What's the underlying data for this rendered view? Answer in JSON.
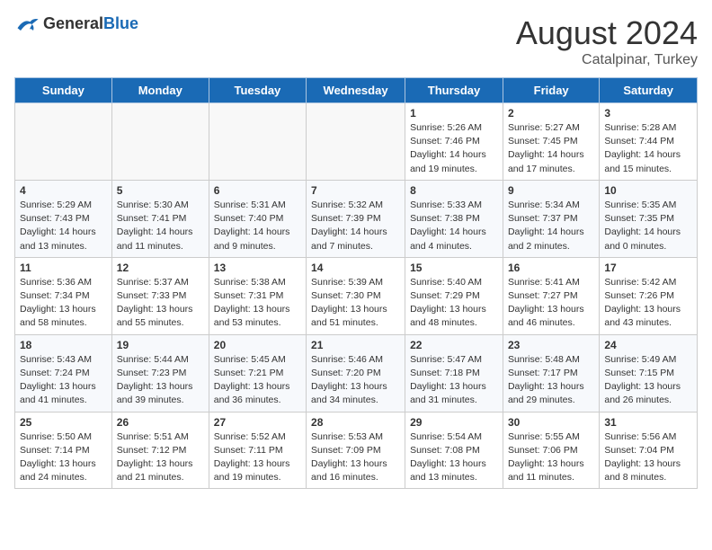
{
  "header": {
    "logo_general": "General",
    "logo_blue": "Blue",
    "month_year": "August 2024",
    "location": "Catalpinar, Turkey"
  },
  "days_of_week": [
    "Sunday",
    "Monday",
    "Tuesday",
    "Wednesday",
    "Thursday",
    "Friday",
    "Saturday"
  ],
  "weeks": [
    [
      {
        "day": "",
        "info": ""
      },
      {
        "day": "",
        "info": ""
      },
      {
        "day": "",
        "info": ""
      },
      {
        "day": "",
        "info": ""
      },
      {
        "day": "1",
        "info": "Sunrise: 5:26 AM\nSunset: 7:46 PM\nDaylight: 14 hours\nand 19 minutes."
      },
      {
        "day": "2",
        "info": "Sunrise: 5:27 AM\nSunset: 7:45 PM\nDaylight: 14 hours\nand 17 minutes."
      },
      {
        "day": "3",
        "info": "Sunrise: 5:28 AM\nSunset: 7:44 PM\nDaylight: 14 hours\nand 15 minutes."
      }
    ],
    [
      {
        "day": "4",
        "info": "Sunrise: 5:29 AM\nSunset: 7:43 PM\nDaylight: 14 hours\nand 13 minutes."
      },
      {
        "day": "5",
        "info": "Sunrise: 5:30 AM\nSunset: 7:41 PM\nDaylight: 14 hours\nand 11 minutes."
      },
      {
        "day": "6",
        "info": "Sunrise: 5:31 AM\nSunset: 7:40 PM\nDaylight: 14 hours\nand 9 minutes."
      },
      {
        "day": "7",
        "info": "Sunrise: 5:32 AM\nSunset: 7:39 PM\nDaylight: 14 hours\nand 7 minutes."
      },
      {
        "day": "8",
        "info": "Sunrise: 5:33 AM\nSunset: 7:38 PM\nDaylight: 14 hours\nand 4 minutes."
      },
      {
        "day": "9",
        "info": "Sunrise: 5:34 AM\nSunset: 7:37 PM\nDaylight: 14 hours\nand 2 minutes."
      },
      {
        "day": "10",
        "info": "Sunrise: 5:35 AM\nSunset: 7:35 PM\nDaylight: 14 hours\nand 0 minutes."
      }
    ],
    [
      {
        "day": "11",
        "info": "Sunrise: 5:36 AM\nSunset: 7:34 PM\nDaylight: 13 hours\nand 58 minutes."
      },
      {
        "day": "12",
        "info": "Sunrise: 5:37 AM\nSunset: 7:33 PM\nDaylight: 13 hours\nand 55 minutes."
      },
      {
        "day": "13",
        "info": "Sunrise: 5:38 AM\nSunset: 7:31 PM\nDaylight: 13 hours\nand 53 minutes."
      },
      {
        "day": "14",
        "info": "Sunrise: 5:39 AM\nSunset: 7:30 PM\nDaylight: 13 hours\nand 51 minutes."
      },
      {
        "day": "15",
        "info": "Sunrise: 5:40 AM\nSunset: 7:29 PM\nDaylight: 13 hours\nand 48 minutes."
      },
      {
        "day": "16",
        "info": "Sunrise: 5:41 AM\nSunset: 7:27 PM\nDaylight: 13 hours\nand 46 minutes."
      },
      {
        "day": "17",
        "info": "Sunrise: 5:42 AM\nSunset: 7:26 PM\nDaylight: 13 hours\nand 43 minutes."
      }
    ],
    [
      {
        "day": "18",
        "info": "Sunrise: 5:43 AM\nSunset: 7:24 PM\nDaylight: 13 hours\nand 41 minutes."
      },
      {
        "day": "19",
        "info": "Sunrise: 5:44 AM\nSunset: 7:23 PM\nDaylight: 13 hours\nand 39 minutes."
      },
      {
        "day": "20",
        "info": "Sunrise: 5:45 AM\nSunset: 7:21 PM\nDaylight: 13 hours\nand 36 minutes."
      },
      {
        "day": "21",
        "info": "Sunrise: 5:46 AM\nSunset: 7:20 PM\nDaylight: 13 hours\nand 34 minutes."
      },
      {
        "day": "22",
        "info": "Sunrise: 5:47 AM\nSunset: 7:18 PM\nDaylight: 13 hours\nand 31 minutes."
      },
      {
        "day": "23",
        "info": "Sunrise: 5:48 AM\nSunset: 7:17 PM\nDaylight: 13 hours\nand 29 minutes."
      },
      {
        "day": "24",
        "info": "Sunrise: 5:49 AM\nSunset: 7:15 PM\nDaylight: 13 hours\nand 26 minutes."
      }
    ],
    [
      {
        "day": "25",
        "info": "Sunrise: 5:50 AM\nSunset: 7:14 PM\nDaylight: 13 hours\nand 24 minutes."
      },
      {
        "day": "26",
        "info": "Sunrise: 5:51 AM\nSunset: 7:12 PM\nDaylight: 13 hours\nand 21 minutes."
      },
      {
        "day": "27",
        "info": "Sunrise: 5:52 AM\nSunset: 7:11 PM\nDaylight: 13 hours\nand 19 minutes."
      },
      {
        "day": "28",
        "info": "Sunrise: 5:53 AM\nSunset: 7:09 PM\nDaylight: 13 hours\nand 16 minutes."
      },
      {
        "day": "29",
        "info": "Sunrise: 5:54 AM\nSunset: 7:08 PM\nDaylight: 13 hours\nand 13 minutes."
      },
      {
        "day": "30",
        "info": "Sunrise: 5:55 AM\nSunset: 7:06 PM\nDaylight: 13 hours\nand 11 minutes."
      },
      {
        "day": "31",
        "info": "Sunrise: 5:56 AM\nSunset: 7:04 PM\nDaylight: 13 hours\nand 8 minutes."
      }
    ]
  ]
}
